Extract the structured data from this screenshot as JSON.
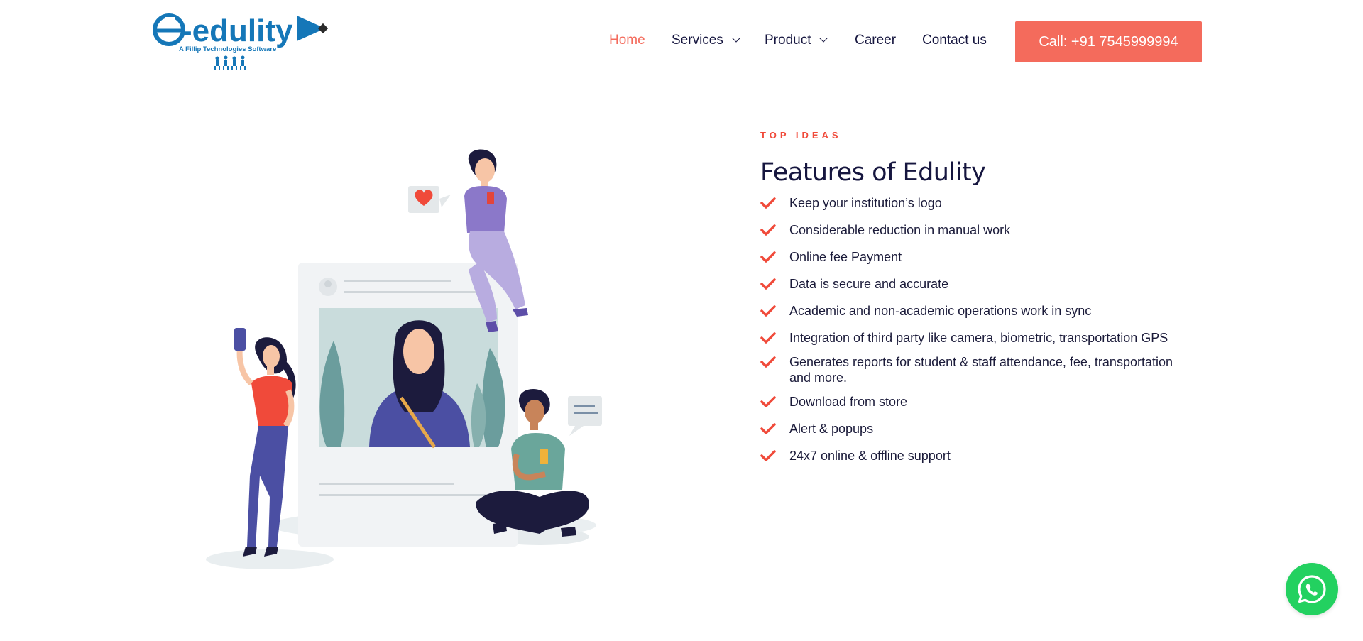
{
  "brand": {
    "logo_text": "e-edulity",
    "logo_tagline": "A Fillip Technologies Software",
    "color": "#1577b8"
  },
  "nav": {
    "items": [
      {
        "label": "Home",
        "active": true,
        "dropdown": false
      },
      {
        "label": "Services",
        "active": false,
        "dropdown": true
      },
      {
        "label": "Product",
        "active": false,
        "dropdown": true
      },
      {
        "label": "Career",
        "active": false,
        "dropdown": false
      },
      {
        "label": "Contact us",
        "active": false,
        "dropdown": false
      }
    ],
    "call_button": "Call: +91 7545999994",
    "accent": "#f46b5c"
  },
  "features": {
    "eyebrow": "TOP IDEAS",
    "title": "Features of Edulity",
    "items": [
      "Keep your institution’s logo",
      "Considerable reduction in manual work",
      "Online fee Payment",
      "Data is secure and accurate",
      "Academic and non-academic operations work in sync",
      "Integration of third party like camera, biometric, transportation GPS",
      "Generates reports for student & staff attendance, fee, transportation and more.",
      "Download from store",
      "Alert & popups",
      "24x7 online & offline support"
    ],
    "check_icon": "check-icon",
    "check_color": "#f04a3a"
  },
  "whatsapp": {
    "icon": "whatsapp-icon",
    "color": "#23d160"
  }
}
